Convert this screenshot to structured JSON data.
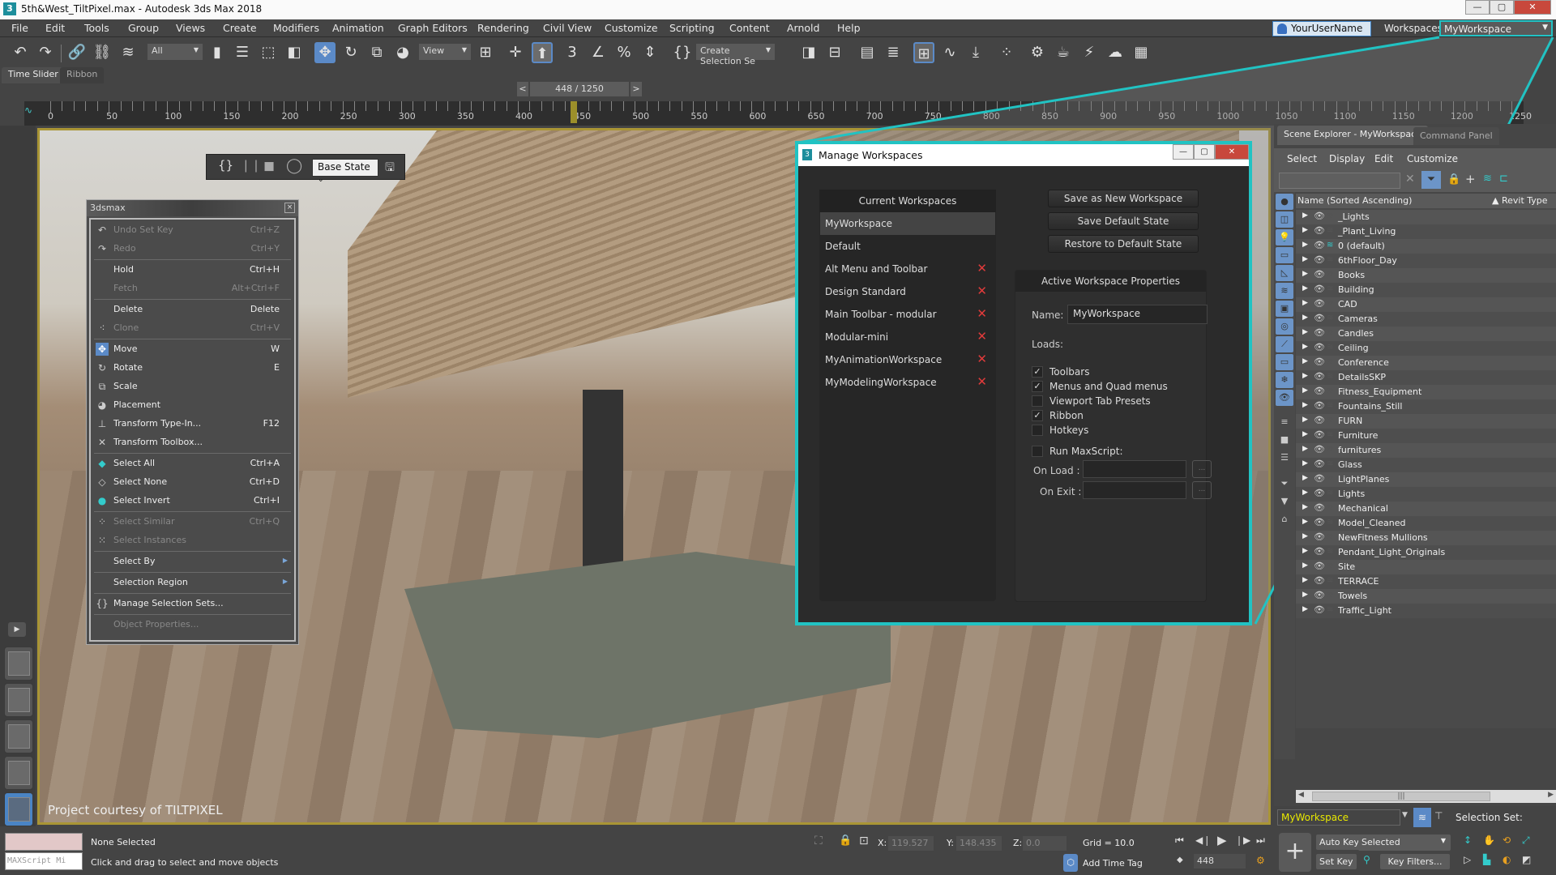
{
  "window": {
    "title": "5th&West_TiltPixel.max - Autodesk 3ds Max 2018",
    "app_icon": "3"
  },
  "menubar": {
    "items": [
      "File",
      "Edit",
      "Tools",
      "Group",
      "Views",
      "Create",
      "Modifiers",
      "Animation",
      "Graph Editors",
      "Rendering",
      "Civil View",
      "Customize",
      "Scripting",
      "Content",
      "Arnold",
      "Help"
    ],
    "user": "YourUserName",
    "workspaces_label": "Workspaces:",
    "workspace_value": "MyWorkspace"
  },
  "toolbar": {
    "selection_filter": "All",
    "reference_coord": "View",
    "named_selection": "Create Selection Se"
  },
  "tabs": {
    "time_slider": "Time Slider",
    "ribbon": "Ribbon"
  },
  "timeslider": {
    "prev": "<",
    "value": "448 / 1250",
    "next": ">",
    "current_frame": 448,
    "total_frames": 1250
  },
  "trackbar": {
    "labels": [
      "0",
      "50",
      "100",
      "150",
      "200",
      "250",
      "300",
      "350",
      "400",
      "450",
      "500",
      "550",
      "600",
      "650",
      "700",
      "750",
      "800",
      "850",
      "900",
      "950",
      "1000",
      "1050",
      "1100",
      "1150",
      "1200",
      "1250"
    ]
  },
  "viewport": {
    "caption": "Project courtesy of TILTPIXEL",
    "state_set": "Base State"
  },
  "quad_menu": {
    "title": "3dsmax",
    "items": [
      {
        "label": "Undo Set Key",
        "shortcut": "Ctrl+Z",
        "disabled": true,
        "icon": "undo-icon"
      },
      {
        "label": "Redo",
        "shortcut": "Ctrl+Y",
        "disabled": true,
        "icon": "redo-icon"
      },
      {
        "label": "Hold",
        "shortcut": "Ctrl+H",
        "disabled": false
      },
      {
        "label": "Fetch",
        "shortcut": "Alt+Ctrl+F",
        "disabled": true
      },
      {
        "label": "Delete",
        "shortcut": "Delete",
        "disabled": false
      },
      {
        "label": "Clone",
        "shortcut": "Ctrl+V",
        "disabled": true,
        "icon": "clone-icon"
      },
      {
        "label": "Move",
        "shortcut": "W",
        "disabled": false,
        "icon": "move-icon"
      },
      {
        "label": "Rotate",
        "shortcut": "E",
        "disabled": false,
        "icon": "rotate-icon"
      },
      {
        "label": "Scale",
        "shortcut": "",
        "disabled": false,
        "icon": "scale-icon"
      },
      {
        "label": "Placement",
        "shortcut": "",
        "disabled": false,
        "icon": "placement-icon"
      },
      {
        "label": "Transform Type-In...",
        "shortcut": "F12",
        "disabled": false,
        "icon": "type-in-icon"
      },
      {
        "label": "Transform Toolbox...",
        "shortcut": "",
        "disabled": false,
        "icon": "toolbox-icon"
      },
      {
        "label": "Select All",
        "shortcut": "Ctrl+A",
        "disabled": false,
        "icon": "select-all-icon"
      },
      {
        "label": "Select None",
        "shortcut": "Ctrl+D",
        "disabled": false,
        "icon": "select-none-icon"
      },
      {
        "label": "Select Invert",
        "shortcut": "Ctrl+I",
        "disabled": false,
        "icon": "select-invert-icon"
      },
      {
        "label": "Select Similar",
        "shortcut": "Ctrl+Q",
        "disabled": true,
        "icon": "select-similar-icon"
      },
      {
        "label": "Select Instances",
        "shortcut": "",
        "disabled": true,
        "icon": "select-instances-icon"
      },
      {
        "label": "Select By",
        "shortcut": "",
        "disabled": false,
        "submenu": true
      },
      {
        "label": "Selection Region",
        "shortcut": "",
        "disabled": false,
        "submenu": true
      },
      {
        "label": "Manage Selection Sets...",
        "shortcut": "",
        "disabled": false,
        "icon": "selection-sets-icon"
      },
      {
        "label": "Object Properties...",
        "shortcut": "",
        "disabled": true
      }
    ]
  },
  "dialog": {
    "title": "Manage Workspaces",
    "current_header": "Current Workspaces",
    "workspaces": [
      {
        "name": "MyWorkspace",
        "selected": true,
        "deletable": false
      },
      {
        "name": "Default",
        "selected": false,
        "deletable": false
      },
      {
        "name": "Alt Menu and Toolbar",
        "selected": false,
        "deletable": true
      },
      {
        "name": "Design Standard",
        "selected": false,
        "deletable": true
      },
      {
        "name": "Main Toolbar - modular",
        "selected": false,
        "deletable": true
      },
      {
        "name": "Modular-mini",
        "selected": false,
        "deletable": true
      },
      {
        "name": "MyAnimationWorkspace",
        "selected": false,
        "deletable": true
      },
      {
        "name": "MyModelingWorkspace",
        "selected": false,
        "deletable": true
      }
    ],
    "buttons": {
      "save_new": "Save as New Workspace",
      "save_default": "Save Default State",
      "restore_default": "Restore to Default State"
    },
    "props": {
      "header": "Active Workspace Properties",
      "name_label": "Name:",
      "name_value": "MyWorkspace",
      "loads_label": "Loads:",
      "loads": [
        {
          "label": "Toolbars",
          "checked": true
        },
        {
          "label": "Menus and Quad menus",
          "checked": true
        },
        {
          "label": "Viewport Tab Presets",
          "checked": false
        },
        {
          "label": "Ribbon",
          "checked": true
        },
        {
          "label": "Hotkeys",
          "checked": false
        }
      ],
      "run_maxscript": {
        "label": "Run MaxScript:",
        "checked": false
      },
      "on_load_label": "On Load :",
      "on_load_value": "",
      "on_exit_label": "On Exit :",
      "on_exit_value": "",
      "browse": "..."
    }
  },
  "scene_explorer": {
    "tab_active": "Scene Explorer - MyWorkspace",
    "tab_other": "Command Panel",
    "menu": [
      "Select",
      "Display",
      "Edit",
      "Customize"
    ],
    "search_value": "",
    "col_name": "Name (Sorted Ascending)",
    "col_revit": "Revit Type",
    "layers": [
      "_Lights",
      "_Plant_Living",
      "0 (default)",
      "6thFloor_Day",
      "Books",
      "Building",
      "CAD",
      "Cameras",
      "Candles",
      "Ceiling",
      "Conference",
      "DetailsSKP",
      "Fitness_Equipment",
      "Fountains_Still",
      "FURN",
      "Furniture",
      "furnitures",
      "Glass",
      "LightPlanes",
      "Lights",
      "Mechanical",
      "Model_Cleaned",
      "NewFitness Mullions",
      "Pendant_Light_Originals",
      "Site",
      "TERRACE",
      "Towels",
      "Traffic_Light"
    ],
    "active_layer": "0 (default)",
    "workspace_select": "MyWorkspace",
    "selection_set_label": "Selection Set:"
  },
  "status": {
    "maxscript_placeholder": "MAXScript Mi",
    "selection": "None Selected",
    "prompt": "Click and drag to select and move objects",
    "x_label": "X:",
    "x": "119.527",
    "y_label": "Y:",
    "y": "148.435",
    "z_label": "Z:",
    "z": "0.0",
    "grid": "Grid = 10.0",
    "add_time_tag": "Add Time Tag",
    "frame": "448",
    "auto_key": "Auto Key",
    "set_key": "Set Key",
    "key_mode": "Selected",
    "key_filters": "Key Filters..."
  },
  "colors": {
    "accent_cyan": "#21c3c3",
    "active_blue": "#5b8ac7",
    "delete_red": "#e23b3b",
    "workspace_yellow": "#e8e800"
  }
}
